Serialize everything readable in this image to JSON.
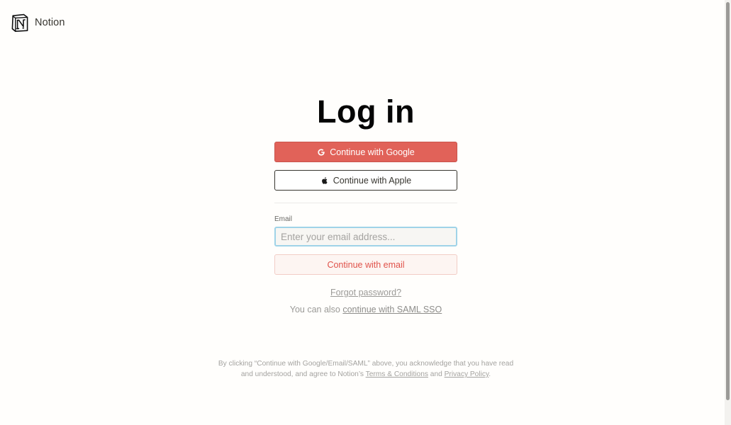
{
  "brand": {
    "name": "Notion",
    "logo_icon": "notion-logo-icon"
  },
  "login": {
    "title": "Log in",
    "google_button": {
      "label": "Continue with Google",
      "icon": "google-g-icon",
      "color": "#e16259"
    },
    "apple_button": {
      "label": "Continue with Apple",
      "icon": "apple-icon"
    },
    "email": {
      "label": "Email",
      "placeholder": "Enter your email address...",
      "value": ""
    },
    "email_button": {
      "label": "Continue with email",
      "color": "#e0524a"
    },
    "forgot_password": "Forgot password?",
    "sso": {
      "prefix": "You can also ",
      "link": "continue with SAML SSO"
    }
  },
  "legal": {
    "text_1": "By clicking “Continue with Google/Email/SAML” above, you acknowledge that you have read and understood, and agree to Notion’s ",
    "terms_link": "Terms & Conditions",
    "and": " and ",
    "privacy_link": "Privacy Policy",
    "end": "."
  }
}
